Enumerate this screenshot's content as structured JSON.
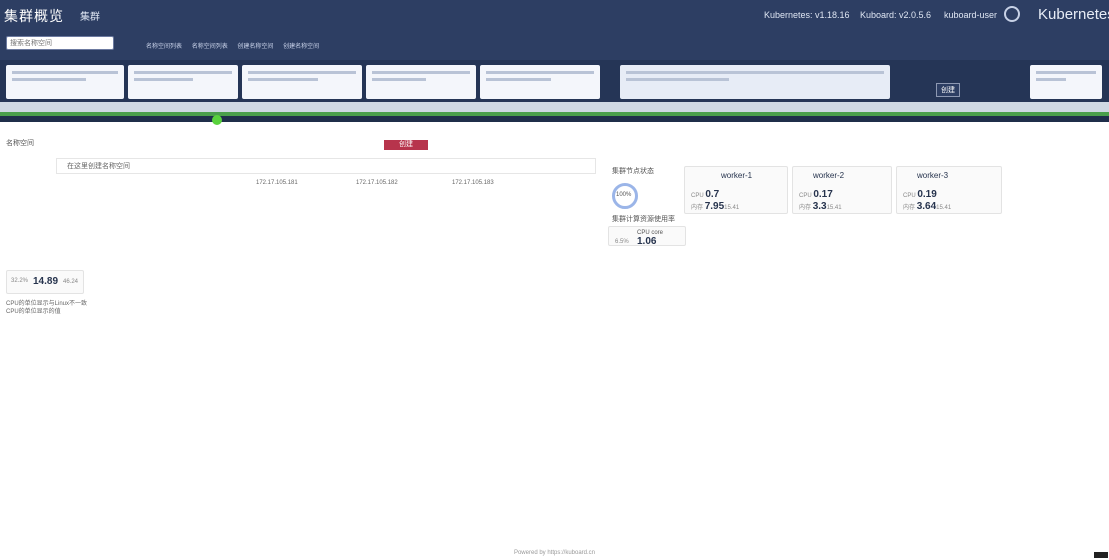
{
  "topbar": {
    "brand": "集群概览",
    "cluster": "集群 ",
    "kubernetes_version": "Kubernetes: v1.18.16",
    "kuboard_version": "Kuboard: v2.0.5.6",
    "user": "kuboard-user",
    "logo": "Kubernetes"
  },
  "search": {
    "placeholder": "搜索名称空间"
  },
  "breadcrumbs": [
    "名称空间列表",
    "名称空间列表",
    "创建名称空间",
    "创建名称空间"
  ],
  "actions": {
    "create_button": "创建"
  },
  "section": {
    "title": "名称空间",
    "primary_button": "创建",
    "hint": "在这里创建名称空间"
  },
  "ips": [
    "172.17.105.181",
    "172.17.105.182",
    "172.17.105.183"
  ],
  "nodes": {
    "title": "集群节点状态",
    "ready_percent": "100%",
    "cards": [
      {
        "name": "worker-1",
        "cpu_label": "CPU",
        "cpu_value": "0.7",
        "mem_label": "内存",
        "mem_value": "7.95",
        "mem_total": "15.41"
      },
      {
        "name": "worker-2",
        "cpu_label": "CPU",
        "cpu_value": "0.17",
        "mem_label": "内存",
        "mem_value": "3.3",
        "mem_total": "15.41"
      },
      {
        "name": "worker-3",
        "cpu_label": "CPU",
        "cpu_value": "0.19",
        "mem_label": "内存",
        "mem_value": "3.64",
        "mem_total": "15.41"
      }
    ]
  },
  "cluster_usage": {
    "title": "集群计算资源使用率",
    "cpu_label": "CPU core",
    "cpu_value": "1.06",
    "cpu_percent": "6.5%"
  },
  "memory": {
    "percent": "32.2%",
    "value": "14.89",
    "total": "46.24"
  },
  "notes": [
    "CPU的单位显示与Linux不一致",
    "CPU的单位显示的值"
  ],
  "footer": "Powered by https://kuboard.cn"
}
